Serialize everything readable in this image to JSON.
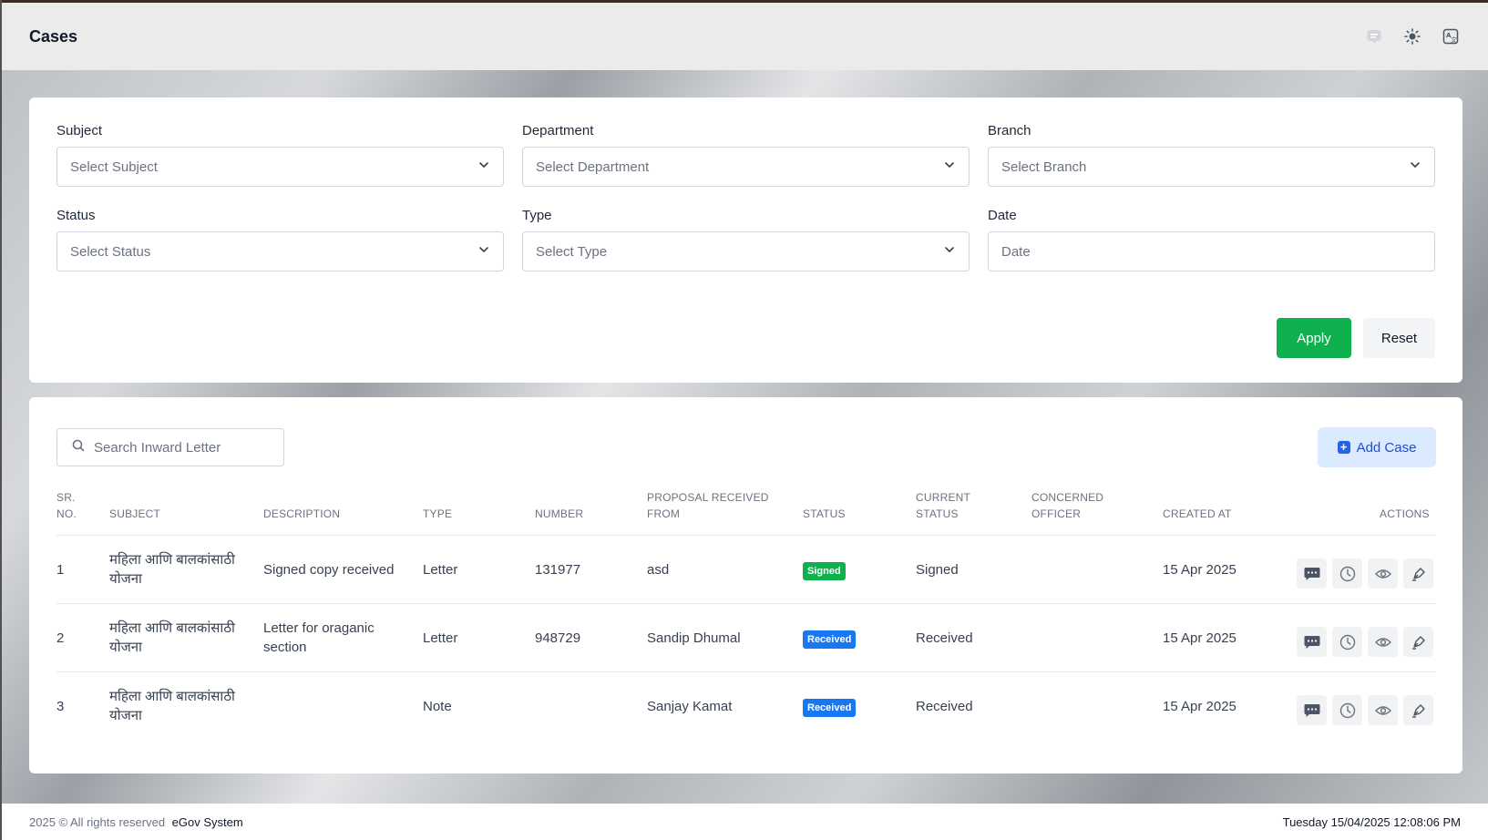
{
  "header": {
    "title": "Cases",
    "icons": [
      "message-icon",
      "sun-icon",
      "translate-icon"
    ]
  },
  "filters": {
    "subject": {
      "label": "Subject",
      "placeholder": "Select Subject"
    },
    "department": {
      "label": "Department",
      "placeholder": "Select Department"
    },
    "branch": {
      "label": "Branch",
      "placeholder": "Select Branch"
    },
    "status": {
      "label": "Status",
      "placeholder": "Select Status"
    },
    "type": {
      "label": "Type",
      "placeholder": "Select Type"
    },
    "date": {
      "label": "Date",
      "placeholder": "Date"
    },
    "apply_label": "Apply",
    "reset_label": "Reset"
  },
  "table": {
    "search_placeholder": "Search Inward Letter",
    "add_label": "Add Case",
    "columns": {
      "sr": "SR. NO.",
      "subject": "SUBJECT",
      "description": "DESCRIPTION",
      "type": "TYPE",
      "number": "NUMBER",
      "from": "PROPOSAL RECEIVED FROM",
      "status": "STATUS",
      "current_status": "CURRENT STATUS",
      "officer": "CONCERNED OFFICER",
      "created": "CREATED AT",
      "actions": "ACTIONS"
    },
    "rows": [
      {
        "sr": "1",
        "subject": "महिला आणि बालकांसाठी योजना",
        "description": "Signed copy received",
        "type": "Letter",
        "number": "131977",
        "from": "asd",
        "status": "Signed",
        "current_status": "Signed",
        "officer": "",
        "created": "15 Apr 2025"
      },
      {
        "sr": "2",
        "subject": "महिला आणि बालकांसाठी योजना",
        "description": "Letter for oraganic section",
        "type": "Letter",
        "number": "948729",
        "from": "Sandip Dhumal",
        "status": "Received",
        "current_status": "Received",
        "officer": "",
        "created": "15 Apr 2025"
      },
      {
        "sr": "3",
        "subject": "महिला आणि बालकांसाठी योजना",
        "description": "",
        "type": "Note",
        "number": "",
        "from": "Sanjay Kamat",
        "status": "Received",
        "current_status": "Received",
        "officer": "",
        "created": "15 Apr 2025"
      }
    ]
  },
  "footer": {
    "copyright": "2025 © All rights reserved",
    "brand": "eGov System",
    "datetime": "Tuesday 15/04/2025 12:08:06 PM"
  },
  "colors": {
    "apply": "#0fb04e",
    "signed": "#0fb04e",
    "received": "#1778f2",
    "add_bg": "#dbeafe"
  }
}
